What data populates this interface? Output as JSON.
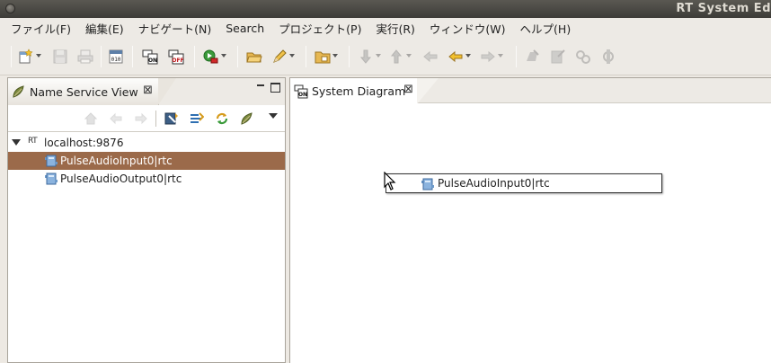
{
  "window": {
    "title": "RT System Ed"
  },
  "menubar": [
    "ファイル(F)",
    "編集(E)",
    "ナビゲート(N)",
    "Search",
    "プロジェクト(P)",
    "実行(R)",
    "ウィンドウ(W)",
    "ヘルプ(H)"
  ],
  "toolbar_icons": [
    "new-wizard-icon",
    "save-icon",
    "print-icon",
    "binary-010-icon",
    "all-on-icon",
    "all-off-icon",
    "run-icon",
    "open-folder-icon",
    "pencil-icon",
    "folder-icon",
    "next-annotation-icon",
    "prev-annotation-icon",
    "back-icon",
    "history-back-icon",
    "forward-icon",
    "ext-tool-1-icon",
    "ext-tool-2-icon",
    "ext-tool-3-icon",
    "ext-tool-4-icon"
  ],
  "name_service_view": {
    "tab_label": "Name Service View",
    "close_glyph": "⊠",
    "tree": {
      "host": {
        "rt_label": "RT",
        "label": "localhost:9876"
      },
      "components": [
        {
          "label": "PulseAudioInput0|rtc",
          "selected": true
        },
        {
          "label": "PulseAudioOutput0|rtc",
          "selected": false
        }
      ]
    }
  },
  "system_diagram": {
    "tab_label": "System Diagram",
    "close_glyph": "⊠",
    "dragged_component": {
      "label": "PulseAudioInput0|rtc"
    }
  },
  "colors": {
    "selection": "#9b6a4a",
    "titlebar": "#3d3c38",
    "chrome": "#edeae5"
  }
}
